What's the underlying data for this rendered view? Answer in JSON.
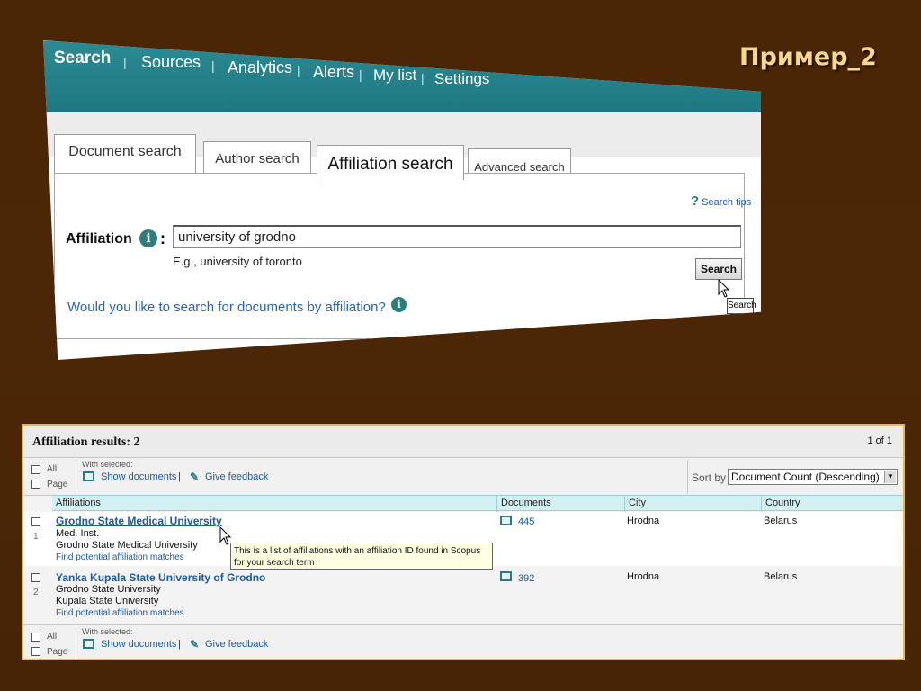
{
  "slide": {
    "title": "Пример_2"
  },
  "nav": {
    "items": [
      "Search",
      "Sources",
      "Analytics",
      "Alerts",
      "My list",
      "Settings"
    ],
    "active": "Search"
  },
  "tabs": [
    "Document search",
    "Author search",
    "Affiliation search",
    "Advanced search"
  ],
  "active_tab": "Affiliation search",
  "search_form": {
    "search_tips": "Search tips",
    "affiliation_label": "Affiliation",
    "input_value": "university of grodno",
    "example_hint": "E.g., university of toronto",
    "search_button": "Search",
    "tooltip": "Search",
    "documents_link": "Would you like to search for documents by affiliation?"
  },
  "results": {
    "title": "Affiliation results: 2",
    "pages": "1  of 1",
    "select_all": "All",
    "select_page": "Page",
    "with_selected": "With selected:",
    "show_documents": "Show documents",
    "give_feedback": "Give feedback",
    "sort_label": "Sort by",
    "sort_value": "Document Count (Descending)",
    "columns": [
      "Affiliations",
      "Documents",
      "City",
      "Country"
    ],
    "rows": [
      {
        "num": "1",
        "name": "Grodno State Medical University",
        "alt_names": [
          "Med. Inst.",
          "Grodno State Medical University"
        ],
        "find_link": "Find potential affiliation matches",
        "documents": "445",
        "city": "Hrodna",
        "country": "Belarus"
      },
      {
        "num": "2",
        "name": "Yanka Kupala State University of Grodno",
        "alt_names": [
          "Grodno State University",
          "Kupala State University"
        ],
        "find_link": "Find potential affiliation matches",
        "documents": "392",
        "city": "Hrodna",
        "country": "Belarus"
      }
    ],
    "hover_tooltip": [
      "This is a list of affiliations with an affiliation ID found in Scopus",
      "for your search term"
    ]
  },
  "colors": {
    "background": "#4a2605",
    "nav_teal": "#1e7882",
    "link_blue": "#1c5aa6",
    "header_cyan": "#d3f0f2",
    "title_gold": "#f7d88e",
    "frame_gold": "#e8b84a"
  }
}
